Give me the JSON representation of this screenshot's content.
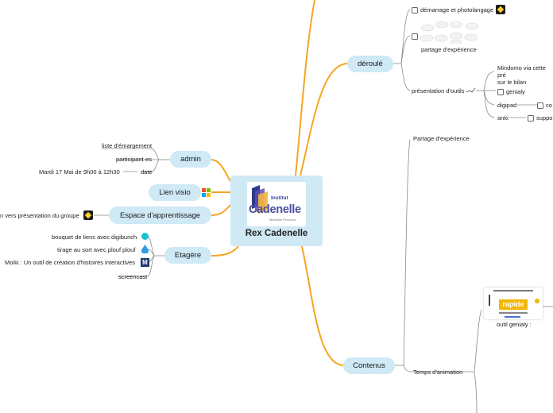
{
  "central": {
    "title": "Rex Cadenelle",
    "logo": {
      "small": "Institut",
      "big": "Cadenelle",
      "sub": "Marseille Provence"
    }
  },
  "left": {
    "admin": {
      "label": "admin",
      "items": [
        "liste d'émargement",
        "participant·es",
        "Mardi 17 Mai de 9h00 à 12h30",
        "date"
      ]
    },
    "visio": {
      "label": "Lien visio",
      "icon": "microsoft-icon"
    },
    "espace": {
      "label": "Espace d'apprentissage",
      "item": "n vers présentation du groupe",
      "icon": "miro-icon"
    },
    "etagere": {
      "label": "Etagère",
      "items": [
        "bouquet de liens avec digibunch",
        "tirage au sort avec plouf plouf",
        "Moiki : Un outil de création d'histoires interactives",
        "screencast"
      ],
      "icons": [
        "digibunch-icon",
        "drop-icon",
        "moiki-icon"
      ]
    }
  },
  "right": {
    "deroule": {
      "label": "déroulé",
      "items": {
        "demarrage": "démarrage et photolangage",
        "partage": "partage d'expérience",
        "outils": "présentation d'outils",
        "mindomo": "Mindomo via cette pré\nsur le bilan",
        "genialy": "genialy",
        "digipad": "digipad",
        "co": "co",
        "anki": "anki",
        "support": "suppo"
      }
    },
    "contenus": {
      "label": "Contenus",
      "items": {
        "partage": "Partage d'expérience",
        "temps": "Temps d'animation",
        "outil_genialy": "outil genialy :",
        "rapide": "rapide"
      }
    }
  },
  "colors": {
    "branch": "#f5a623",
    "node": "#cfe9f5",
    "line": "#888888"
  }
}
